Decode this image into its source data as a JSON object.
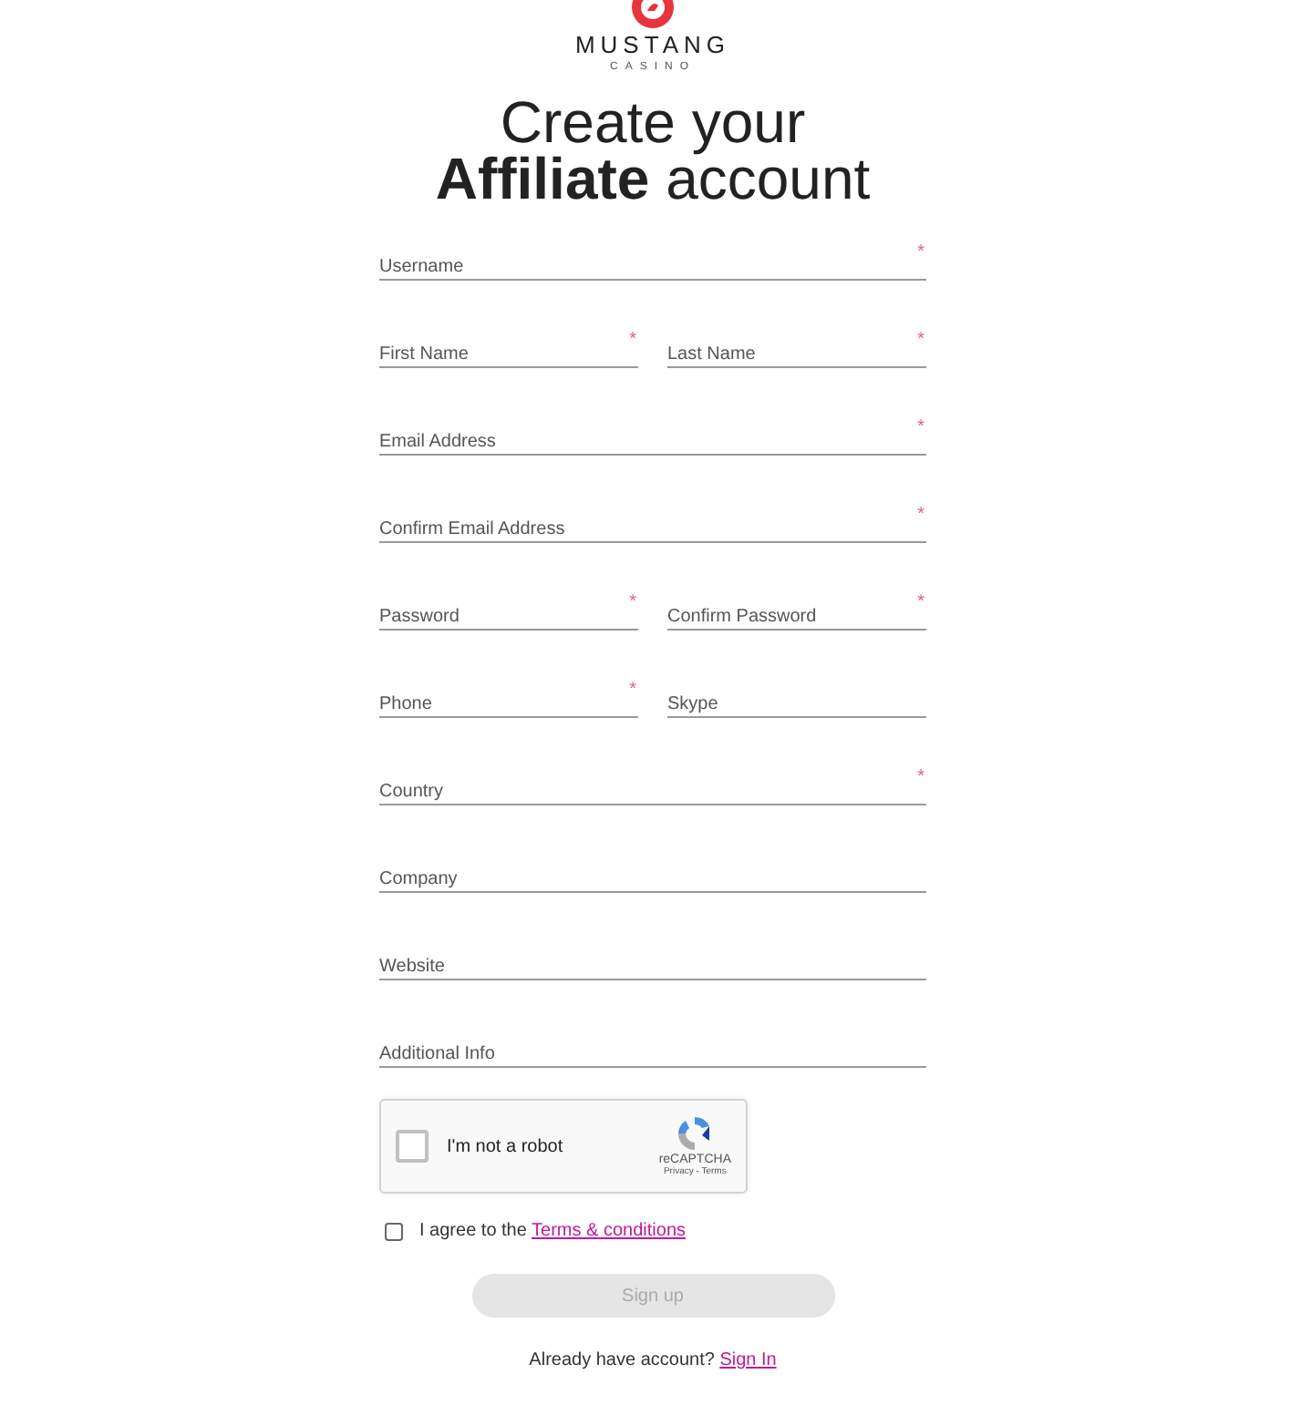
{
  "logo": {
    "name": "MUSTANG",
    "tagline": "CASINO"
  },
  "heading": {
    "line_1": "Create your",
    "line_2": "**Affiliate** account"
  },
  "form_rows": [
    [
      {
        "label": "Username",
        "required": true
      }
    ],
    [
      {
        "label": "First Name",
        "required": true
      },
      {
        "label": "Last Name",
        "required": true
      }
    ],
    [
      {
        "label": "Email Address",
        "required": true
      }
    ],
    [
      {
        "label": "Confirm Email Address",
        "required": true
      }
    ],
    [
      {
        "label": "Password",
        "required": true
      },
      {
        "label": "Confirm Password",
        "required": true
      }
    ],
    [
      {
        "label": "Phone",
        "required": true
      },
      {
        "label": "Skype",
        "required": false
      }
    ],
    [
      {
        "label": "Country",
        "required": true
      }
    ],
    [
      {
        "label": "Company",
        "required": false
      }
    ],
    [
      {
        "label": "Website",
        "required": false
      }
    ],
    [
      {
        "label": "Additional Info",
        "required": false
      }
    ]
  ],
  "required_mark": "*",
  "captcha": {
    "label": "I'm not a robot",
    "checked": false,
    "brand": "reCAPTCHA",
    "links": "Privacy - Terms"
  },
  "agree": {
    "text": "I agree to the",
    "link": "Terms & conditions",
    "checked": false
  },
  "submit": {
    "label": "Sign up",
    "disabled": true
  },
  "footer": {
    "text": "Already have account?",
    "link": "Sign In"
  }
}
